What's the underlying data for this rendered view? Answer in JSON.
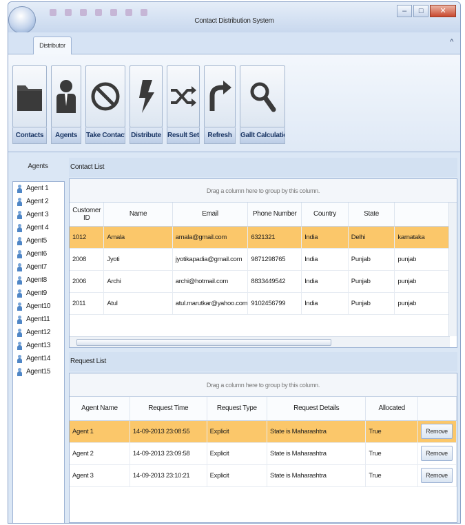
{
  "window": {
    "title": "Contact Distribution System",
    "controls": {
      "minimize": "–",
      "maximize": "□",
      "close": "✕"
    }
  },
  "ribbon": {
    "tab_label": "Distributor",
    "collapse_glyph": "^",
    "buttons": [
      {
        "label": "Contacts",
        "icon": "folder-icon"
      },
      {
        "label": "Agents",
        "icon": "agent-icon"
      },
      {
        "label": "Take Contacts",
        "icon": "prohibit-icon"
      },
      {
        "label": "Distribute",
        "icon": "lightning-icon"
      },
      {
        "label": "Result Set",
        "icon": "shuffle-icon"
      },
      {
        "label": "Refresh",
        "icon": "refresh-icon"
      },
      {
        "label": "Gallt Calculation",
        "icon": "magnifier-icon"
      }
    ]
  },
  "agents_panel": {
    "header": "Agents",
    "items": [
      "Agent 1",
      "Agent 2",
      "Agent 3",
      "Agent 4",
      "Agent5",
      "Agent6",
      "Agent7",
      "Agent8",
      "Agent9",
      "Agent10",
      "Agent11",
      "Agent12",
      "Agent13",
      "Agent14",
      "Agent15"
    ]
  },
  "contact_list": {
    "header": "Contact List",
    "drag_hint": "Drag a column here to group by this column.",
    "columns": [
      "Customer ID",
      "Name",
      "Email",
      "Phone Number",
      "Country",
      "State",
      ""
    ],
    "rows": [
      [
        "1012",
        "Amala",
        "amala@gmail.com",
        "6321321",
        "India",
        "Delhi",
        "karnataka"
      ],
      [
        "2008",
        "Jyoti",
        "jyotikapadia@gmail.com",
        "9871298765",
        "India",
        "Punjab",
        "punjab"
      ],
      [
        "2006",
        "Archi",
        "archi@hotmail.com",
        "8833449542",
        "India",
        "Punjab",
        "punjab"
      ],
      [
        "2011",
        "Atul",
        "atul.marutkar@yahoo.com",
        "9102456799",
        "India",
        "Punjab",
        "punjab"
      ]
    ]
  },
  "request_list": {
    "header": "Request List",
    "drag_hint": "Drag a column here to group by this column.",
    "columns": [
      "Agent Name",
      "Request Time",
      "Request Type",
      "Request Details",
      "Allocated",
      ""
    ],
    "rows": [
      [
        "Agent 1",
        "14-09-2013 23:08:55",
        "Explicit",
        "State is Maharashtra",
        "True",
        "Remove"
      ],
      [
        "Agent 2",
        "14-09-2013 23:09:58",
        "Explicit",
        "State is Maharashtra",
        "True",
        "Remove"
      ],
      [
        "Agent 3",
        "14-09-2013 23:10:21",
        "Explicit",
        "State is Maharashtra",
        "True",
        "Remove"
      ]
    ]
  }
}
